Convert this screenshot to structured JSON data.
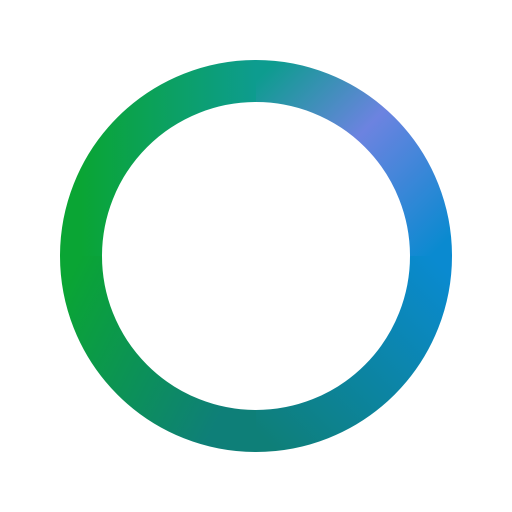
{
  "logo": {
    "icon": "gradient-ring-icon",
    "colors": {
      "green": "#0aa534",
      "teal": "#0d9c8f",
      "periwinkle": "#6c83e0",
      "blue": "#0a8ad0",
      "deep_teal": "#0e7f78",
      "background": "#ffffff"
    }
  }
}
